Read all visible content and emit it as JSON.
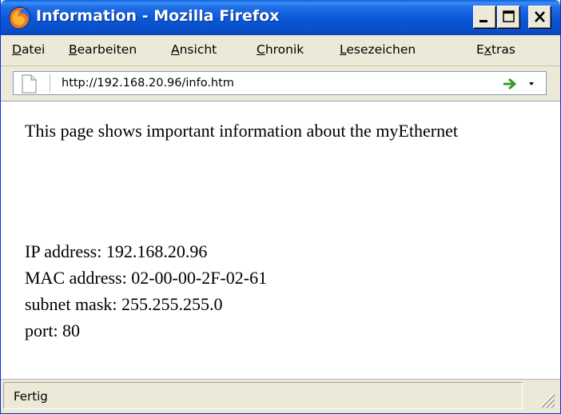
{
  "window": {
    "title": "Information - Mozilla Firefox",
    "title_bar_color": "#0a57d6",
    "icons": {
      "app": "firefox-icon",
      "minimize": "minimize-icon",
      "maximize": "maximize-icon",
      "close": "close-icon"
    }
  },
  "menu": {
    "items": [
      {
        "first": "D",
        "rest": "atei"
      },
      {
        "first": "B",
        "rest": "earbeiten"
      },
      {
        "first": "A",
        "rest": "nsicht"
      },
      {
        "first": "C",
        "rest": "hronik"
      },
      {
        "first": "L",
        "rest": "esezeichen"
      },
      {
        "first": "E",
        "underline": "x",
        "rest": "tras"
      }
    ]
  },
  "navigation": {
    "url": "http://192.168.20.96/info.htm",
    "icons": {
      "page": "page-icon",
      "go": "go-arrow-icon",
      "dropdown": "dropdown-arrow-icon"
    },
    "go_color": "#3a9b2a"
  },
  "content": {
    "intro": "This page shows important information about the myEthernet",
    "lines": [
      "IP address: 192.168.20.96",
      "MAC address: 02-00-00-2F-02-61",
      "subnet mask: 255.255.255.0",
      "port: 80"
    ]
  },
  "status": {
    "text": "Fertig",
    "icons": {
      "grip": "resize-grip-icon"
    }
  }
}
